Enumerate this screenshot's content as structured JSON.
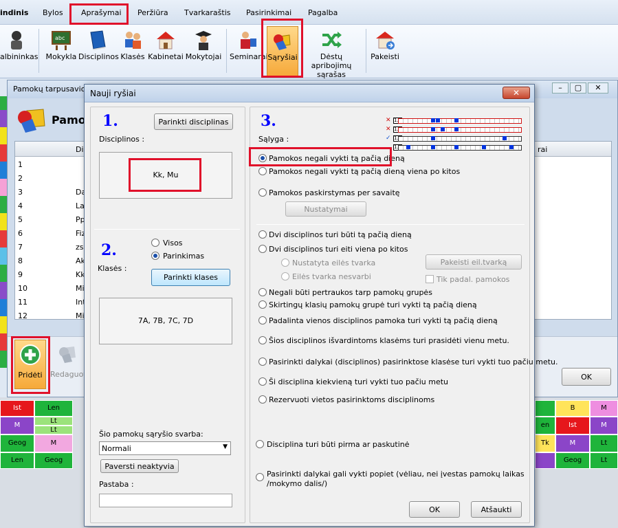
{
  "menu": {
    "items": [
      "Pagrindinis",
      "Bylos",
      "Aprašymai",
      "Peržiūra",
      "Tvarkaraštis",
      "Pasirinkimai",
      "Pagalba"
    ],
    "visible_items": [
      "indinis",
      "Bylos",
      "Aprašymai",
      "Peržiūra",
      "Tvarkaraštis",
      "Pasirinkimai",
      "Pagalba"
    ],
    "active": "Aprašymai"
  },
  "ribbon": {
    "buttons": [
      {
        "label": "albininkas",
        "icon": "teacher-icon"
      },
      {
        "label": "Mokykla",
        "icon": "school-board-icon"
      },
      {
        "label": "Disciplinos",
        "icon": "book-icon"
      },
      {
        "label": "Klasės",
        "icon": "students-icon"
      },
      {
        "label": "Kabinetai",
        "icon": "house-icon"
      },
      {
        "label": "Mokytojai",
        "icon": "graduate-icon"
      },
      {
        "label": "Seminarai",
        "icon": "seminar-icon"
      },
      {
        "label": "Sąryšiai",
        "icon": "shapes-icon"
      },
      {
        "label": "Dėstų apribojimų sąrašas",
        "icon": "shuffle-icon"
      },
      {
        "label": "Pakeisti",
        "icon": "house-change-icon"
      }
    ],
    "active": "Sąryšiai"
  },
  "background_window": {
    "title": "Pamokų tarpusavio",
    "heading": "Pamo",
    "column_header": "Dis",
    "right_column_header": "rai",
    "rows": [
      {
        "n": "1",
        "d": ""
      },
      {
        "n": "2",
        "d": ""
      },
      {
        "n": "3",
        "d": "Da"
      },
      {
        "n": "4",
        "d": "La"
      },
      {
        "n": "5",
        "d": "Pp"
      },
      {
        "n": "6",
        "d": "Fiz"
      },
      {
        "n": "7",
        "d": "zs"
      },
      {
        "n": "8",
        "d": "Ak"
      },
      {
        "n": "9",
        "d": "Kk"
      },
      {
        "n": "10",
        "d": "Mi"
      },
      {
        "n": "11",
        "d": "Int"
      },
      {
        "n": "12",
        "d": "Mi"
      }
    ],
    "add_button": "Pridėti",
    "edit_button": "Redaguoti",
    "ok_button": "OK"
  },
  "grid_left": [
    [
      "Ist",
      "Len"
    ],
    [
      "M",
      "Lt"
    ],
    [
      "",
      "Lt"
    ],
    [
      "Geog",
      "M"
    ],
    [
      "Len",
      "Geog"
    ]
  ],
  "grid_right": [
    [
      "",
      "B",
      "M"
    ],
    [
      "en",
      "Ist",
      "M"
    ],
    [
      "Tk",
      "M",
      "Lt"
    ],
    [
      "",
      "Geog",
      "Lt"
    ]
  ],
  "dialog": {
    "title": "Nauji ryšiai",
    "close": "✕",
    "step1": "1.",
    "step2": "2.",
    "step3": "3.",
    "choose_disciplines": "Parinkti disciplinas",
    "disciplines_label": "Disciplinos :",
    "disciplines_value": "Kk, Mu",
    "class_visos": "Visos",
    "class_parinkimas": "Parinkimas",
    "classes_label": "Klasės :",
    "choose_classes": "Parinkti klases",
    "classes_value": "7A, 7B, 7C, 7D",
    "weight_label": "Šio pamokų sąryšio svarba:",
    "weight_value": "Normali",
    "make_inactive": "Paversti neaktyvia",
    "note_label": "Pastaba :",
    "note_value": "",
    "condition_label": "Sąlyga :",
    "conditions": [
      "Pamokos negali vykti tą pačią dieną",
      "Pamokos negali vykti tą pačią dieną viena po kitos",
      "Pamokos paskirstymas per savaitę"
    ],
    "settings_button": "Nustatymai",
    "conditions2": [
      "Dvi disciplinos turi būti tą pačią dieną",
      "Dvi disciplinos turi eiti viena po kitos"
    ],
    "order_fixed": "Nustatyta eilės tvarka",
    "order_any": "Eilės tvarka nesvarbi",
    "change_order": "Pakeisti eil.tvarką",
    "only_pad": "Tik padal. pamokos",
    "conditions3": [
      "Negali būti pertraukos tarp pamokų grupės",
      "Skirtingų klasių pamokų grupė turi vykti tą pačią dieną",
      "Padalinta vienos disciplinos pamoka turi vykti tą pačią dieną",
      "Šios disciplinos išvardintoms klasėms turi prasidėti vienu metu.",
      "Pasirinkti dalykai (disciplinos) pasirinktose klasėse turi vykti tuo pačiu metu.",
      "Ši disciplina kiekvieną turi vykti tuo pačiu metu",
      "Rezervuoti vietos pasirinktoms disciplinoms"
    ],
    "first_last": "Disciplina turi būti pirma ar paskutinė",
    "afternoon_1": "Pasirinkti dalykai gali vykti popiet (vėliau, nei įvestas pamokų laikas",
    "afternoon_2": "/mokymo dalis/)",
    "ok": "OK",
    "cancel": "Atšaukti",
    "timeline_markers": [
      "✕",
      "✕",
      "✓",
      ""
    ],
    "timeline_tag": "1.2"
  }
}
